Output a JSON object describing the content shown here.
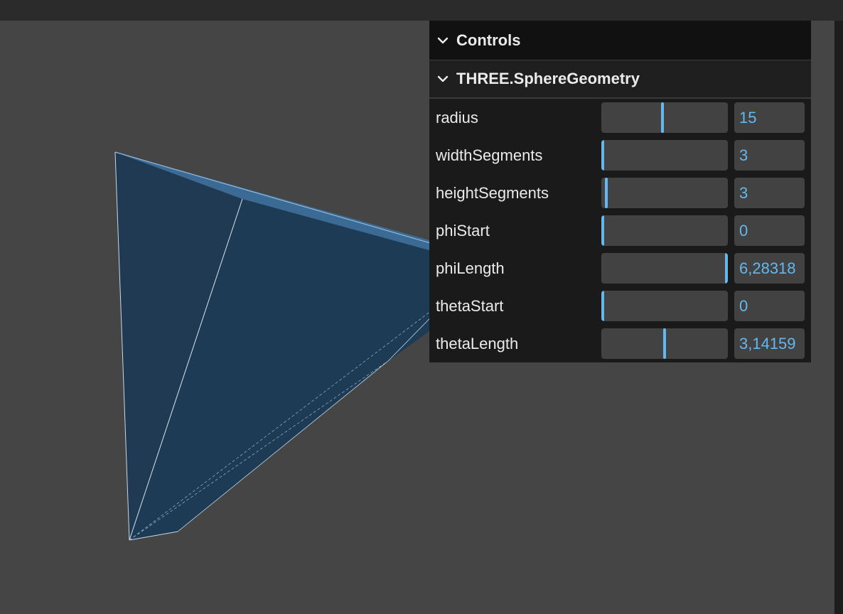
{
  "gui": {
    "title": "Controls",
    "folder": {
      "title": "THREE.SphereGeometry",
      "params": [
        {
          "label": "radius",
          "value": "15",
          "fraction": 0.48
        },
        {
          "label": "widthSegments",
          "value": "3",
          "fraction": 0.0
        },
        {
          "label": "heightSegments",
          "value": "3",
          "fraction": 0.03
        },
        {
          "label": "phiStart",
          "value": "0",
          "fraction": 0.0
        },
        {
          "label": "phiLength",
          "value": "6,28318",
          "fraction": 1.0
        },
        {
          "label": "thetaStart",
          "value": "0",
          "fraction": 0.0
        },
        {
          "label": "thetaLength",
          "value": "3,14159",
          "fraction": 0.5
        }
      ]
    }
  },
  "icons": {
    "collapse": "chevron-down-icon"
  },
  "colors": {
    "accent": "#63b8f0",
    "mesh_fill": "#1d3b55",
    "mesh_wire": "#c8d8e6",
    "background": "#454545"
  }
}
